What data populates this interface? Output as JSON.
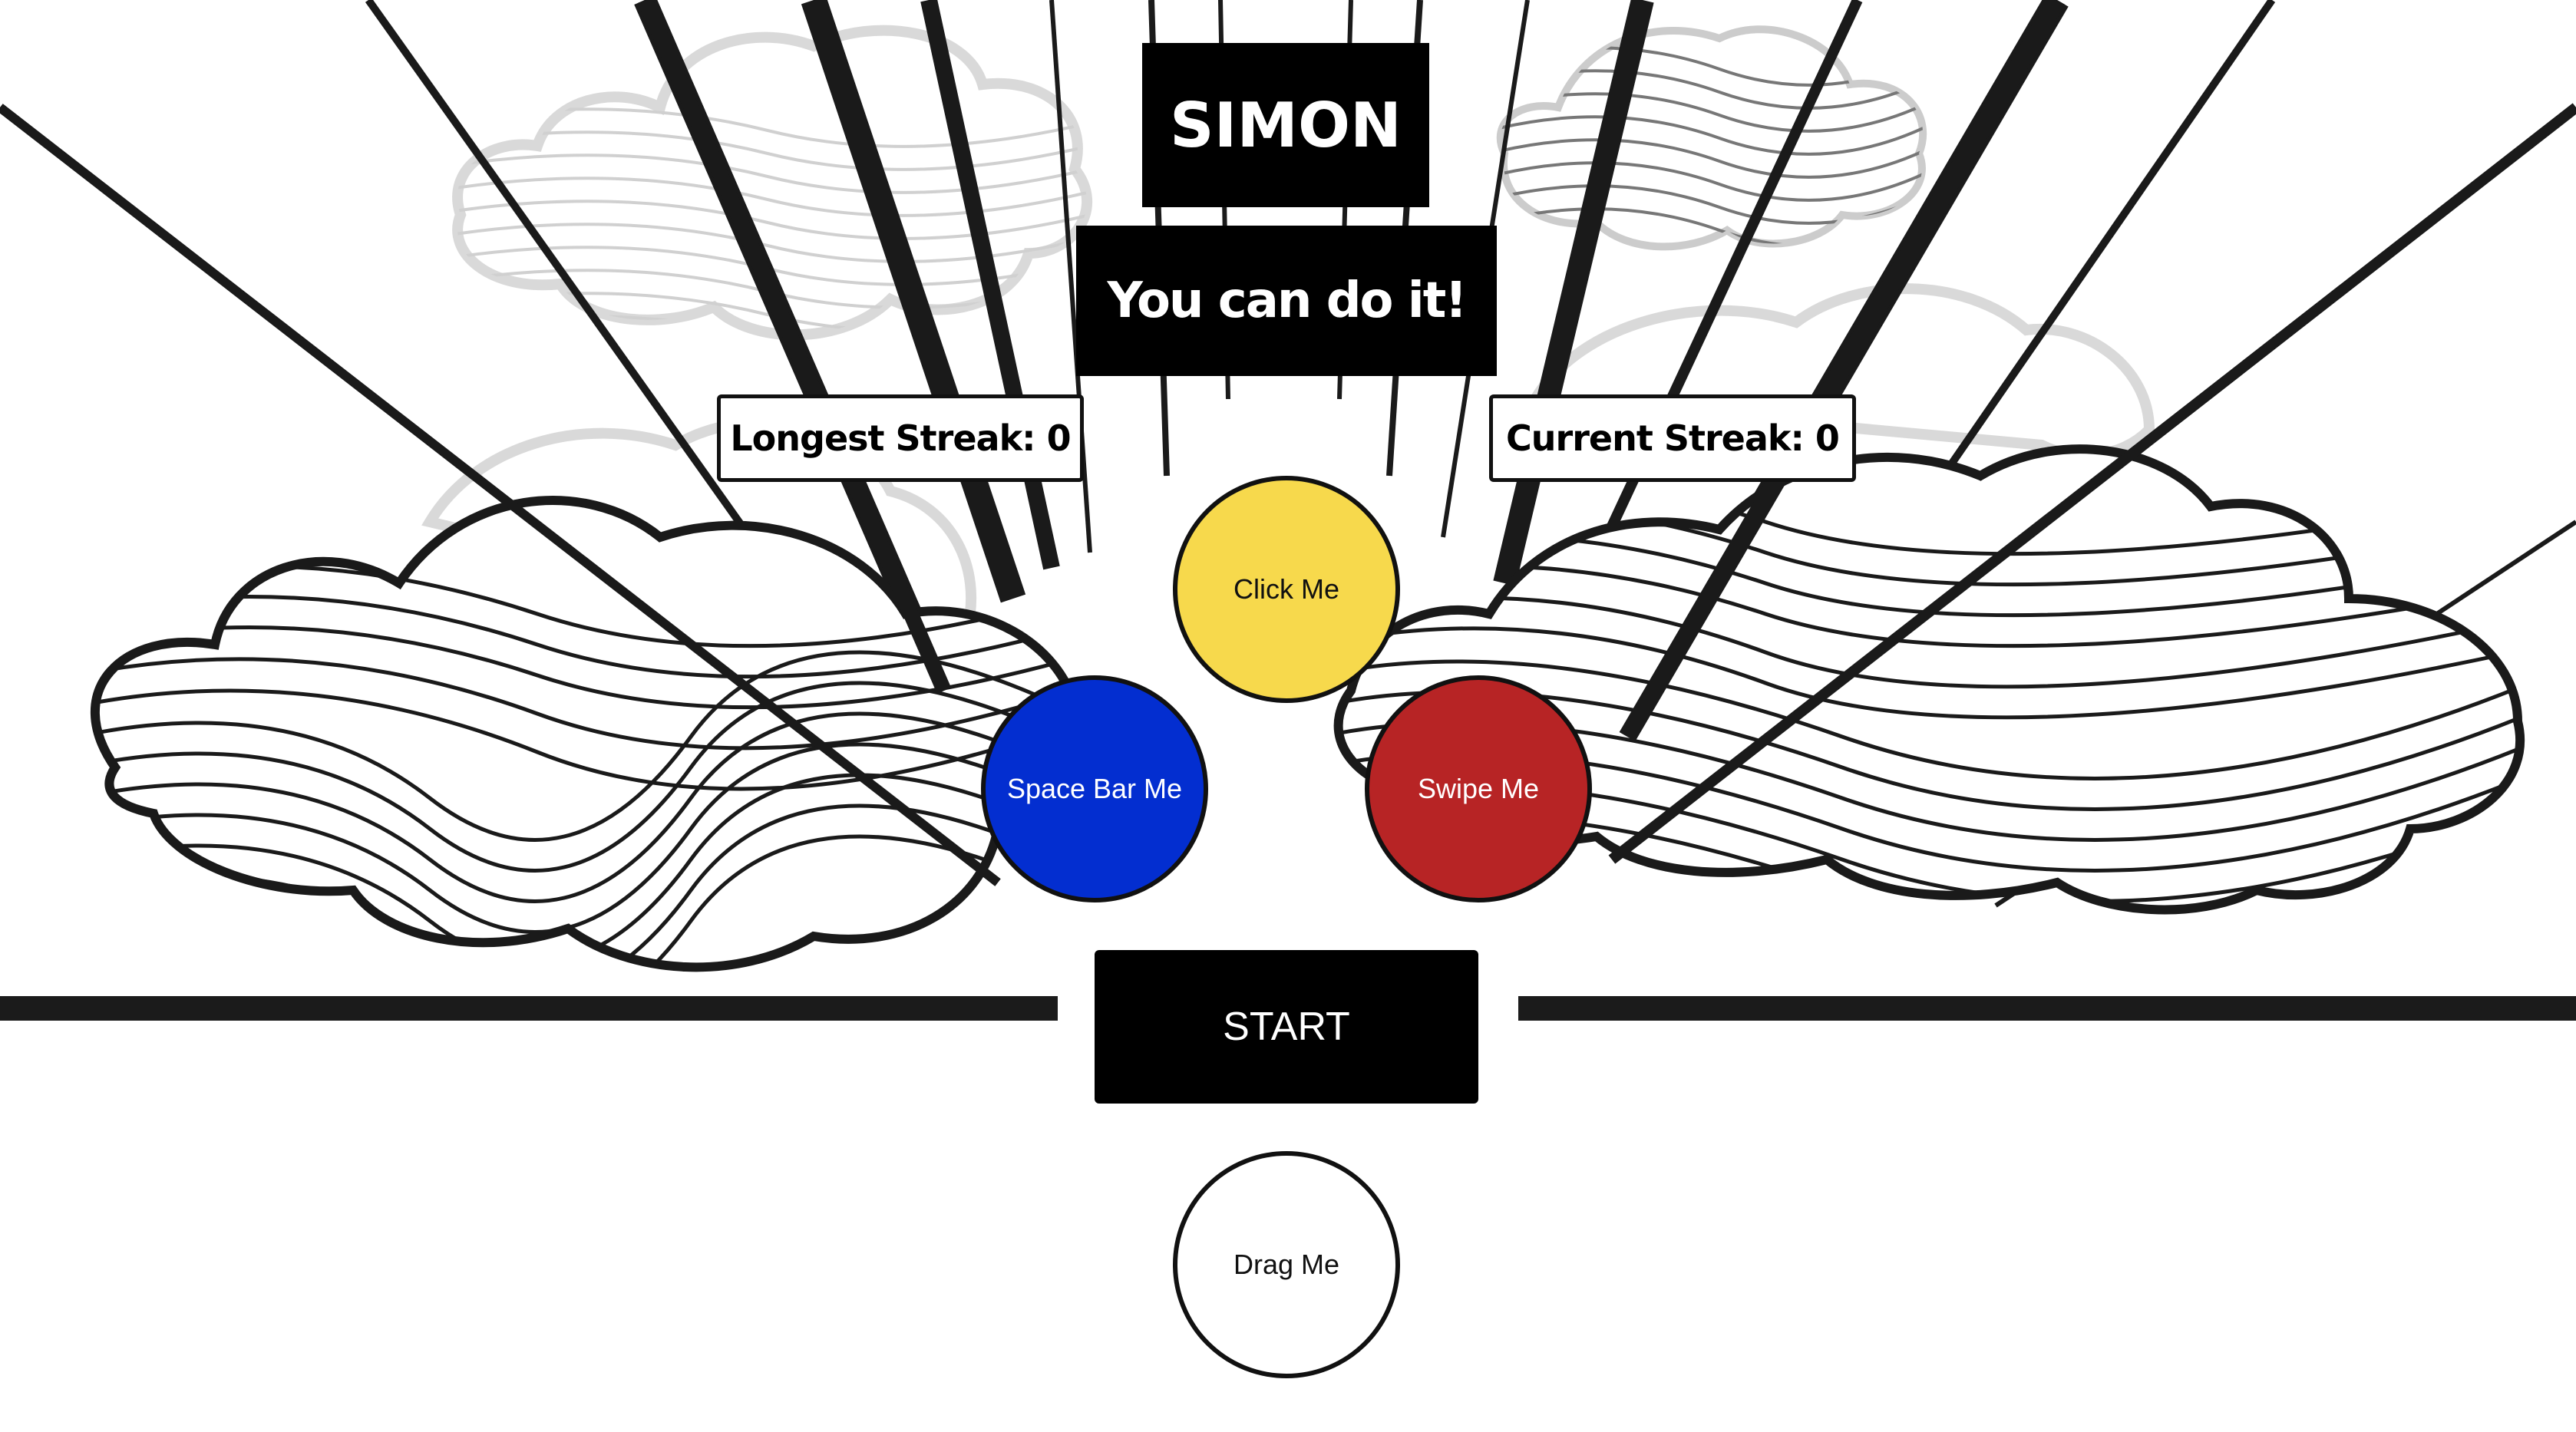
{
  "title": "SIMON",
  "subtitle": "You can do it!",
  "streaks": {
    "longest": "Longest Streak: 0",
    "current": "Current Streak: 0"
  },
  "buttons": {
    "yellow": "Click Me",
    "blue": "Space Bar Me",
    "red": "Swipe Me",
    "drag": "Drag Me",
    "start": "START"
  },
  "colors": {
    "yellow": "#f7d94c",
    "blue": "#032ed0",
    "red": "#b72425",
    "ink": "#111111"
  }
}
